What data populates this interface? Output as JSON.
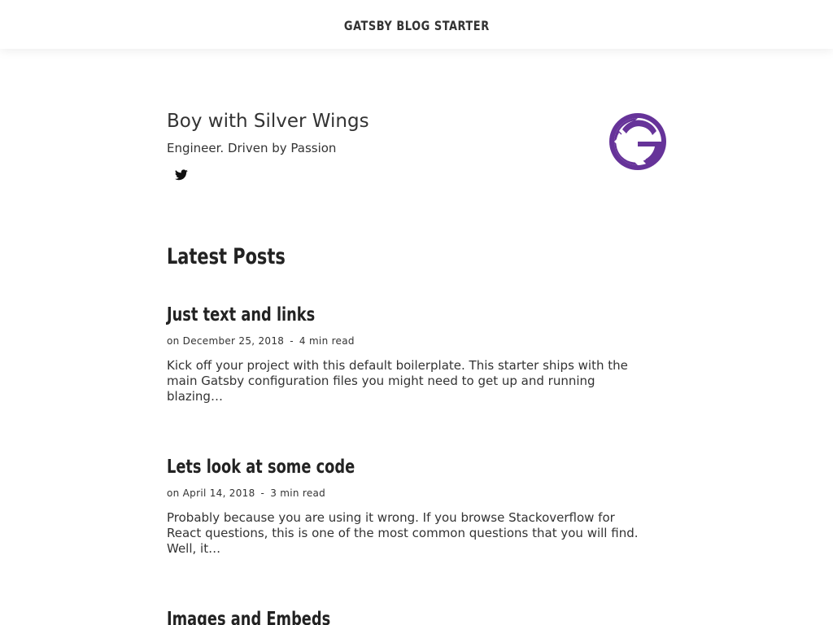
{
  "navbar": {
    "brand": "GATSBY BLOG STARTER"
  },
  "bio": {
    "name": "Boy with Silver Wings",
    "tagline": "Engineer. Driven by Passion",
    "social_icon": "twitter-icon",
    "avatar_icon": "gatsby-logo-icon",
    "avatar_color": "#663399"
  },
  "latest": {
    "heading": "Latest Posts",
    "posts": [
      {
        "title": "Just text and links",
        "date": "on December 25, 2018",
        "separator": "-",
        "read_time": "4 min read",
        "excerpt": "Kick off your project with this default boilerplate. This starter ships with the main Gatsby configuration files you might need to get up and running blazing…"
      },
      {
        "title": "Lets look at some code",
        "date": "on April 14, 2018",
        "separator": "-",
        "read_time": "3 min read",
        "excerpt": "Probably because you are using it wrong. If you browse Stackoverflow for React questions, this is one of the most common questions that you will find. Well, it…"
      },
      {
        "title": "Images and Embeds",
        "date": "",
        "separator": "",
        "read_time": "",
        "excerpt": ""
      }
    ]
  }
}
